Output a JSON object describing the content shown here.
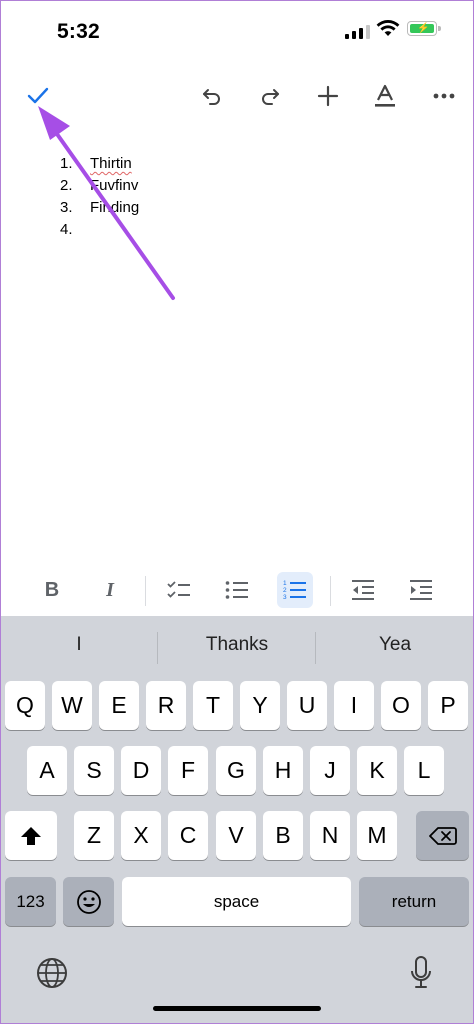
{
  "status_bar": {
    "time": "5:32"
  },
  "toolbar": {
    "done": "checkmark-icon",
    "undo": "undo-icon",
    "redo": "redo-icon",
    "insert": "plus-icon",
    "text_format": "text-format-icon",
    "more": "more-icon"
  },
  "document": {
    "list": [
      {
        "num": "1.",
        "text": "Thirtin"
      },
      {
        "num": "2.",
        "text": "Fuvfinv"
      },
      {
        "num": "3.",
        "text": "Finding"
      },
      {
        "num": "4.",
        "text": ""
      }
    ]
  },
  "format_toolbar": {
    "bold": "B",
    "italic": "I",
    "checklist": "checklist-icon",
    "bulleted_list": "bulleted-list-icon",
    "numbered_list": "numbered-list-icon",
    "decrease_indent": "decrease-indent-icon",
    "increase_indent": "increase-indent-icon",
    "active_color": "#e3edfb"
  },
  "keyboard": {
    "suggestions": [
      "I",
      "Thanks",
      "Yea"
    ],
    "row1": [
      "Q",
      "W",
      "E",
      "R",
      "T",
      "Y",
      "U",
      "I",
      "O",
      "P"
    ],
    "row2": [
      "A",
      "S",
      "D",
      "F",
      "G",
      "H",
      "J",
      "K",
      "L"
    ],
    "row3": [
      "Z",
      "X",
      "C",
      "V",
      "B",
      "N",
      "M"
    ],
    "numbers_key": "123",
    "space_key": "space",
    "return_key": "return",
    "shift": "shift-icon",
    "delete": "delete-icon",
    "emoji": "emoji-icon",
    "globe": "globe-icon",
    "mic": "microphone-icon"
  },
  "colors": {
    "accent": "#1a73e8",
    "arrow": "#a64ee6",
    "keyboard_bg": "#d1d4da"
  }
}
